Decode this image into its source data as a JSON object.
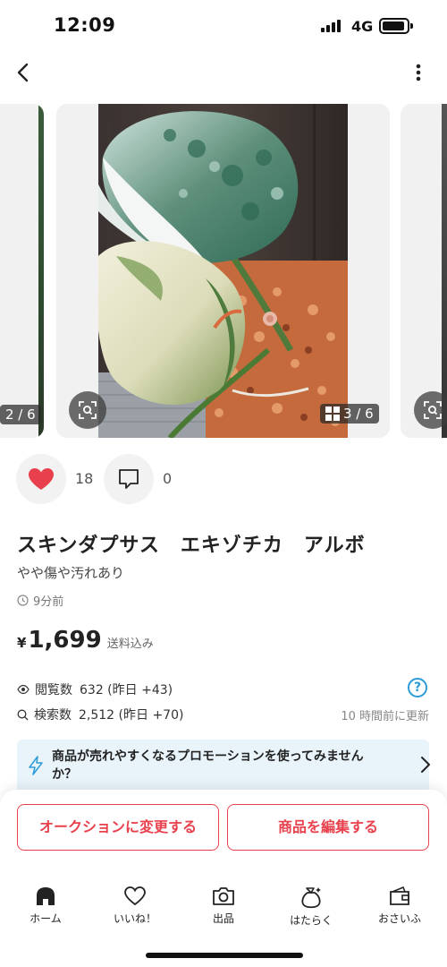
{
  "status_bar": {
    "time": "12:09",
    "network": "4G"
  },
  "gallery": {
    "left_counter": "2 / 6",
    "main_counter": "3 / 6"
  },
  "engagement": {
    "likes": "18",
    "comments": "0"
  },
  "item": {
    "title": "スキンダプサス　エキゾチカ　アルボ",
    "condition": "やや傷や汚れあり",
    "posted": "9分前",
    "price_currency": "¥",
    "price": "1,699",
    "shipping": "送料込み"
  },
  "stats": {
    "views_label": "閲覧数",
    "views_value": "632 (昨日 +43)",
    "search_label": "検索数",
    "search_value": "2,512 (昨日 +70)",
    "help": "?",
    "updated": "10 時間前に更新"
  },
  "promo": {
    "text": "商品が売れやすくなるプロモーションを使ってみませんか？"
  },
  "buttons": {
    "auction": "オークションに変更する",
    "edit": "商品を編集する"
  },
  "tabs": [
    {
      "label": "ホーム",
      "icon": "home-icon"
    },
    {
      "label": "いいね！",
      "icon": "heart-outline-icon"
    },
    {
      "label": "出品",
      "icon": "camera-icon"
    },
    {
      "label": "はたらく",
      "icon": "money-bag-icon"
    },
    {
      "label": "おさいふ",
      "icon": "wallet-icon"
    }
  ],
  "colors": {
    "accent": "#e8414d",
    "info": "#2b9bd8",
    "promo_bg": "#e9f4fa"
  }
}
